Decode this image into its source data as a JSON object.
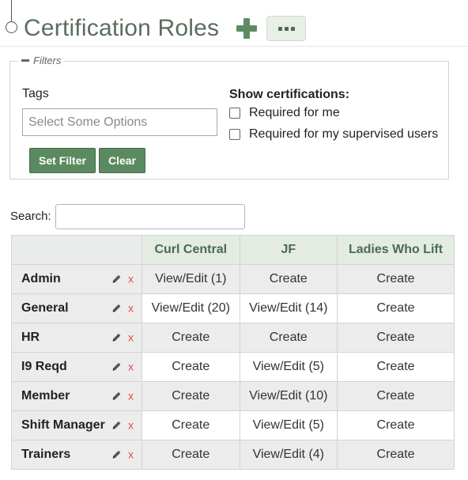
{
  "header": {
    "title": "Certification Roles",
    "add_icon": "plus-icon",
    "more_icon": "ellipsis-icon"
  },
  "filters": {
    "legend": "Filters",
    "tags_label": "Tags",
    "tags_placeholder": "Select Some Options",
    "show_label": "Show certifications:",
    "checkbox_required_for_me": "Required for me",
    "checkbox_required_supervised": "Required for my supervised users",
    "set_filter_label": "Set Filter",
    "clear_label": "Clear"
  },
  "search": {
    "label": "Search:",
    "value": ""
  },
  "table": {
    "columns": [
      "Curl Central",
      "JF",
      "Ladies Who Lift"
    ],
    "rows": [
      {
        "name": "Admin",
        "cells": [
          "View/Edit (1)",
          "Create",
          "Create"
        ]
      },
      {
        "name": "General",
        "cells": [
          "View/Edit (20)",
          "View/Edit (14)",
          "Create"
        ]
      },
      {
        "name": "HR",
        "cells": [
          "Create",
          "Create",
          "Create"
        ]
      },
      {
        "name": "I9 Reqd",
        "cells": [
          "Create",
          "View/Edit (5)",
          "Create"
        ]
      },
      {
        "name": "Member",
        "cells": [
          "Create",
          "View/Edit (10)",
          "Create"
        ]
      },
      {
        "name": "Shift Manager",
        "cells": [
          "Create",
          "View/Edit (5)",
          "Create"
        ]
      },
      {
        "name": "Trainers",
        "cells": [
          "Create",
          "View/Edit (4)",
          "Create"
        ]
      }
    ],
    "row_icons": {
      "edit": "pencil-icon",
      "delete": "delete-x-icon",
      "delete_glyph": "x"
    }
  },
  "colors": {
    "accent_green": "#5b8a60",
    "title_gray_green": "#5a6d5f",
    "header_bg": "#e3ebe3",
    "delete_red": "#d9534f"
  }
}
